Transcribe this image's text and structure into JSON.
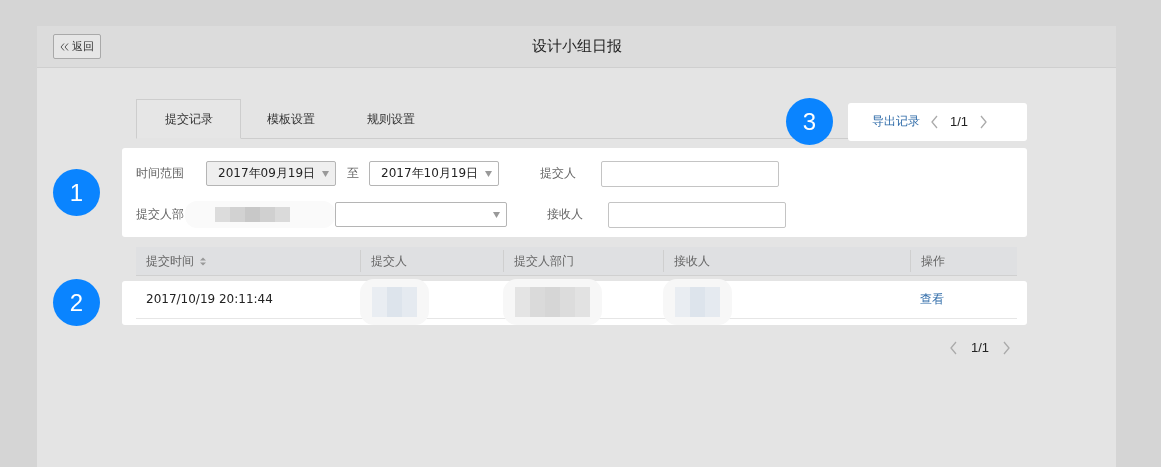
{
  "window": {
    "title": "设计小组日报",
    "back_button": "返回"
  },
  "tabs": [
    {
      "label": "提交记录",
      "selected": true
    },
    {
      "label": "模板设置",
      "selected": false
    },
    {
      "label": "规则设置",
      "selected": false
    }
  ],
  "export_panel": {
    "callout": "3",
    "export_link": "导出记录",
    "page": "1/1"
  },
  "filters": {
    "callout": "1",
    "time_range_label": "时间范围",
    "start_date": "2017年09月19日",
    "range_separator": "至",
    "end_date": "2017年10月19日",
    "submitter_label": "提交人",
    "department_label": "提交人部",
    "receiver_label": "接收人"
  },
  "table": {
    "callout": "2",
    "columns": [
      {
        "label": "提交时间",
        "sortable": true
      },
      {
        "label": "提交人",
        "sortable": false
      },
      {
        "label": "提交人部门",
        "sortable": false
      },
      {
        "label": "接收人",
        "sortable": false
      },
      {
        "label": "操作",
        "sortable": false
      }
    ],
    "rows": [
      {
        "cells": [
          {
            "kind": "text",
            "text": "2017/10/19 20:11:44"
          },
          {
            "kind": "redacted"
          },
          {
            "kind": "redacted"
          },
          {
            "kind": "redacted"
          },
          {
            "kind": "link",
            "text": "查看"
          }
        ]
      }
    ]
  },
  "pagination": {
    "page": "1/1"
  }
}
